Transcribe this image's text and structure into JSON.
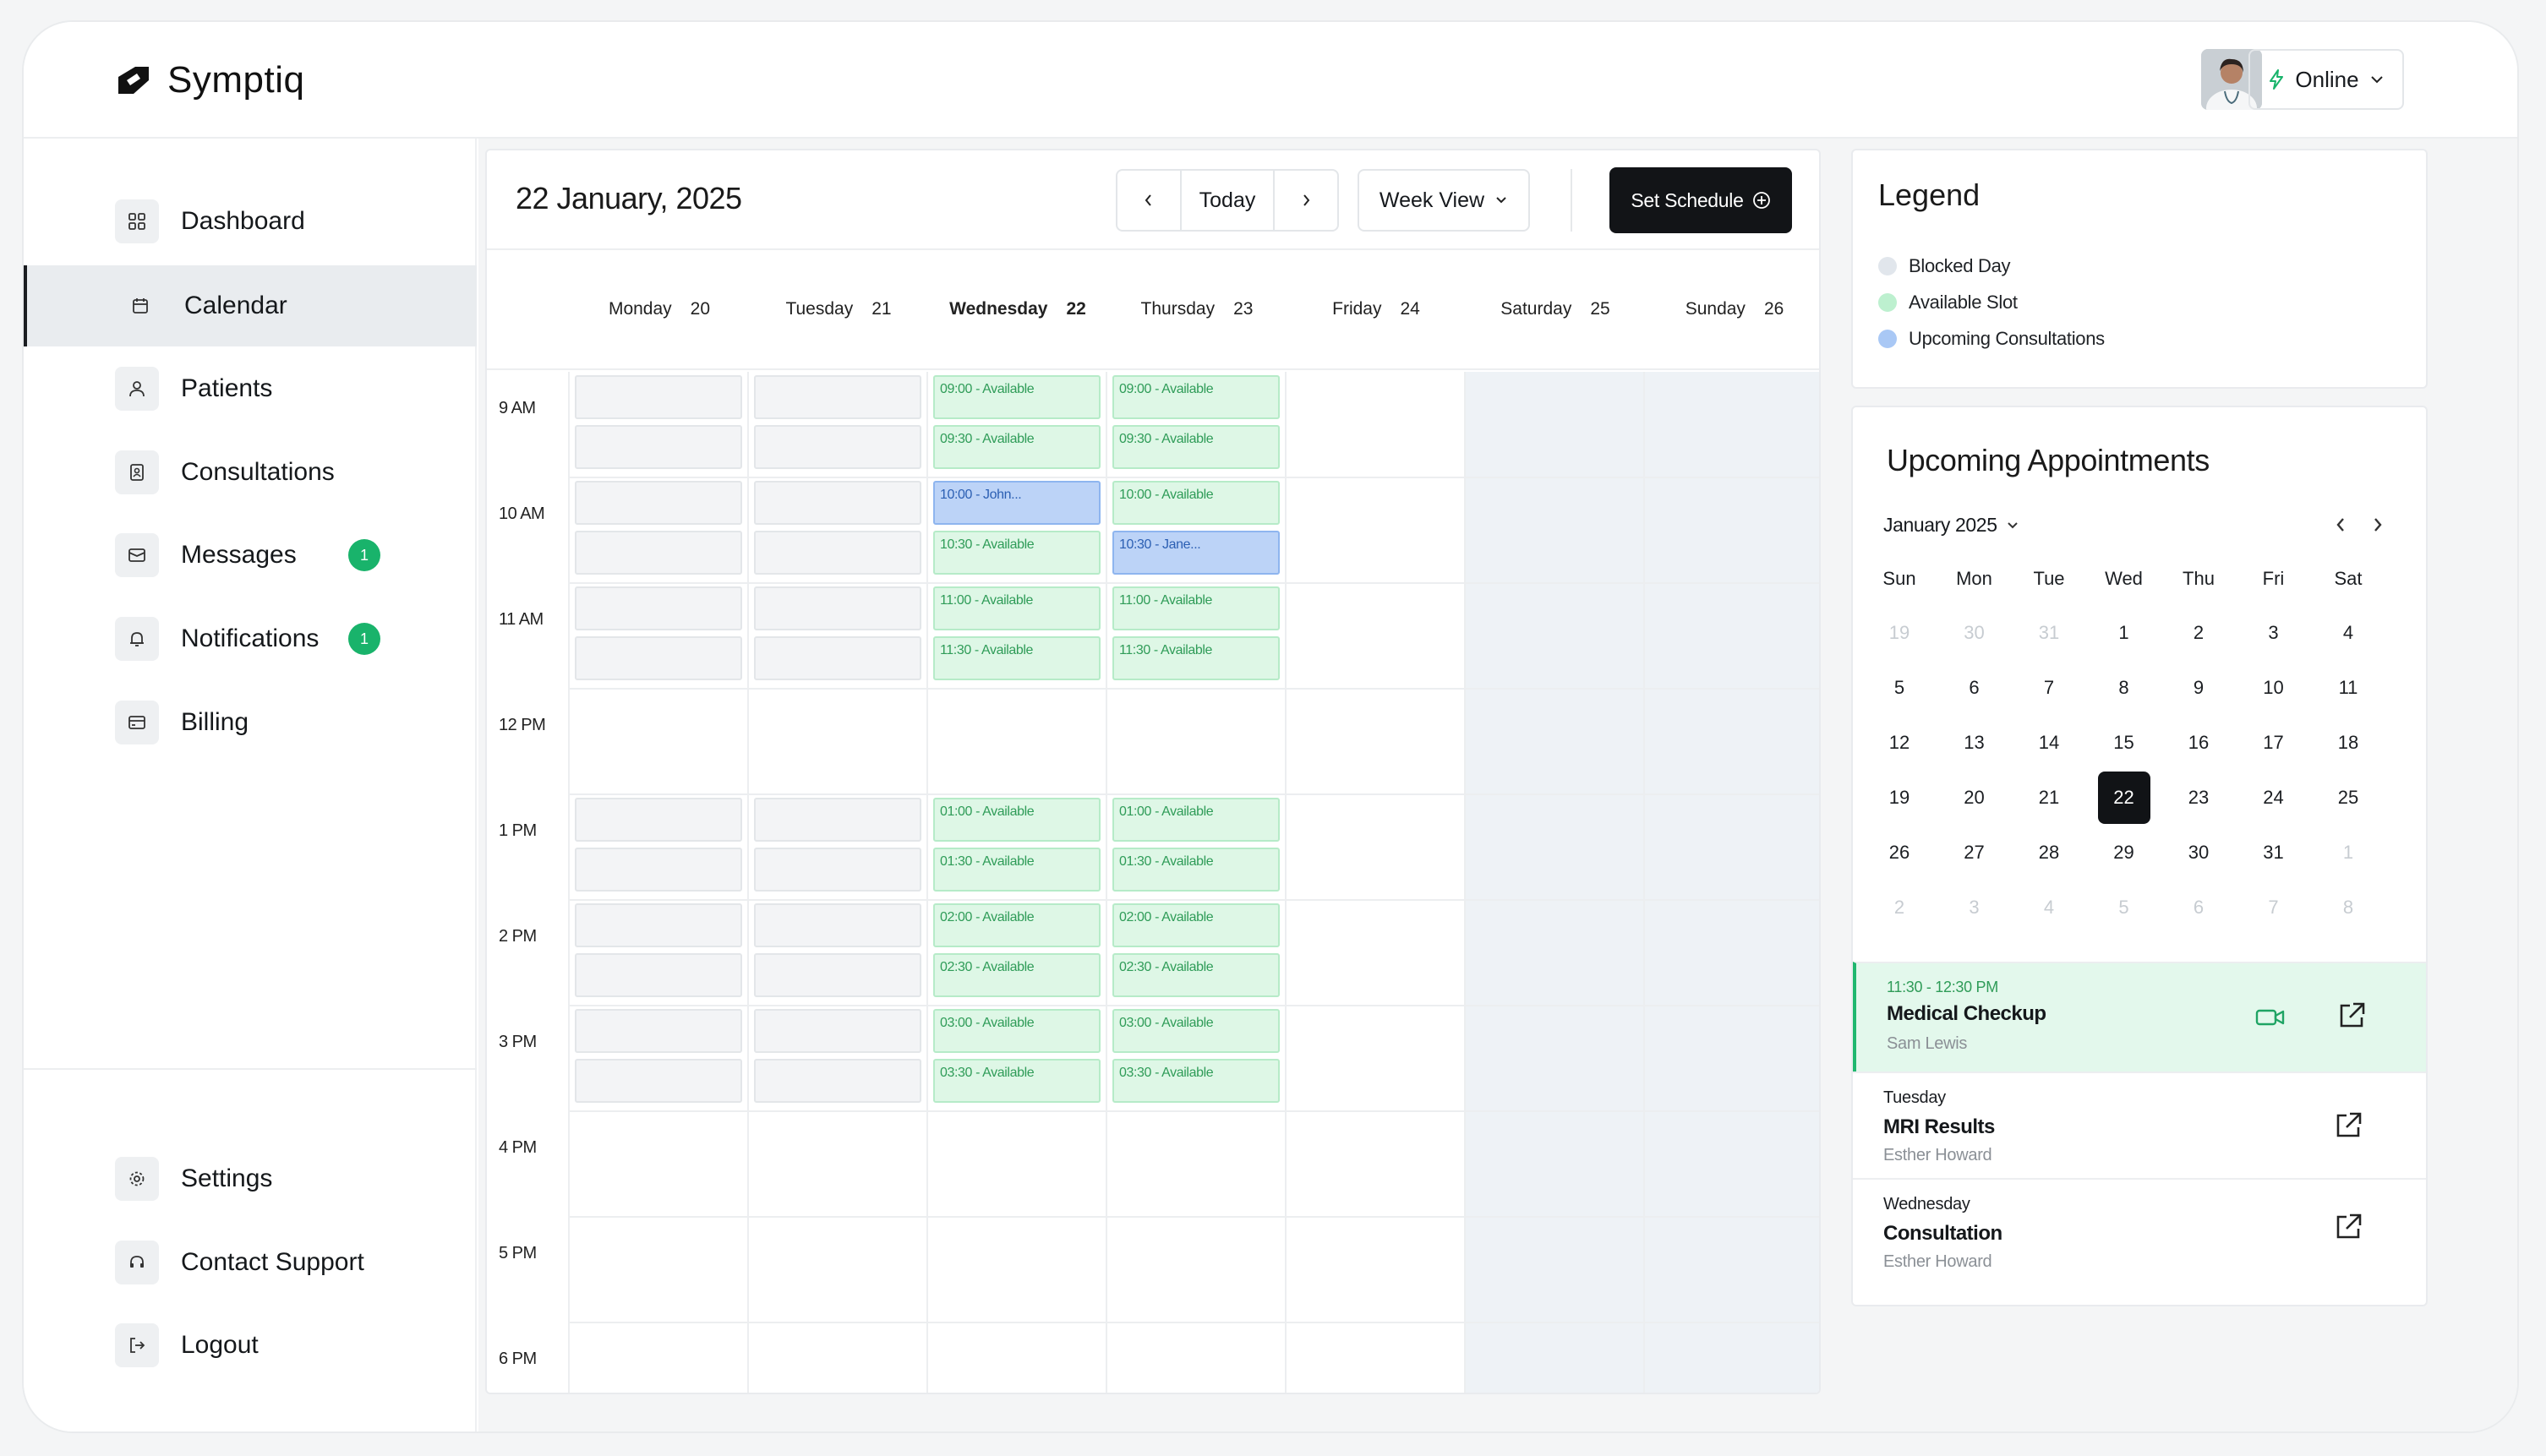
{
  "brand": {
    "name": "Symptiq"
  },
  "header": {
    "status_label": "Online"
  },
  "sidebar": {
    "items": [
      {
        "label": "Dashboard"
      },
      {
        "label": "Calendar"
      },
      {
        "label": "Patients"
      },
      {
        "label": "Consultations"
      },
      {
        "label": "Messages",
        "badge": "1"
      },
      {
        "label": "Notifications",
        "badge": "1"
      },
      {
        "label": "Billing"
      }
    ],
    "bottom": [
      {
        "label": "Settings"
      },
      {
        "label": "Contact Support"
      },
      {
        "label": "Logout"
      }
    ]
  },
  "calendar": {
    "date_title": "22 January, 2025",
    "today_label": "Today",
    "view_label": "Week View",
    "schedule_label": "Set Schedule",
    "days": [
      {
        "name": "Monday",
        "num": "20"
      },
      {
        "name": "Tuesday",
        "num": "21"
      },
      {
        "name": "Wednesday",
        "num": "22"
      },
      {
        "name": "Thursday",
        "num": "23"
      },
      {
        "name": "Friday",
        "num": "24"
      },
      {
        "name": "Saturday",
        "num": "25"
      },
      {
        "name": "Sunday",
        "num": "26"
      }
    ],
    "times": [
      "9 AM",
      "10 AM",
      "11 AM",
      "12 PM",
      "1 PM",
      "2 PM",
      "3 PM",
      "4 PM",
      "5 PM",
      "6 PM"
    ],
    "wednesday": [
      "09:00 - Available",
      "09:30 - Available",
      "10:00 - John...",
      "10:30 - Available",
      "11:00 - Available",
      "11:30 - Available",
      "01:00 - Available",
      "01:30 - Available",
      "02:00 - Available",
      "02:30 - Available",
      "03:00 - Available",
      "03:30 - Available"
    ],
    "thursday": [
      "09:00 - Available",
      "09:30 - Available",
      "10:00 - Available",
      "10:30 - Jane...",
      "11:00 - Available",
      "11:30 - Available",
      "01:00 - Available",
      "01:30 - Available",
      "02:00 - Available",
      "02:30 - Available",
      "03:00 - Available",
      "03:30 - Available"
    ]
  },
  "legend": {
    "title": "Legend",
    "items": [
      {
        "label": "Blocked Day",
        "color": "#e1e6ec"
      },
      {
        "label": "Available Slot",
        "color": "#bdf0cf"
      },
      {
        "label": "Upcoming Consultations",
        "color": "#a9c8f5"
      }
    ]
  },
  "appointments": {
    "title": "Upcoming Appointments",
    "month_label": "January 2025",
    "weekdays": [
      "Sun",
      "Mon",
      "Tue",
      "Wed",
      "Thu",
      "Fri",
      "Sat"
    ],
    "weeks": [
      [
        "19",
        "30",
        "31",
        "1",
        "2",
        "3",
        "4"
      ],
      [
        "5",
        "6",
        "7",
        "8",
        "9",
        "10",
        "11"
      ],
      [
        "12",
        "13",
        "14",
        "15",
        "16",
        "17",
        "18"
      ],
      [
        "19",
        "20",
        "21",
        "22",
        "23",
        "24",
        "25"
      ],
      [
        "26",
        "27",
        "28",
        "29",
        "30",
        "31",
        "1"
      ],
      [
        "2",
        "3",
        "4",
        "5",
        "6",
        "7",
        "8"
      ]
    ],
    "selected_day": "22",
    "items": [
      {
        "time": "11:30 - 12:30 PM",
        "title": "Medical Checkup",
        "patient": "Sam Lewis"
      },
      {
        "day": "Tuesday",
        "title": "MRI Results",
        "patient": "Esther Howard"
      },
      {
        "day": "Wednesday",
        "title": "Consultation",
        "patient": "Esther Howard"
      }
    ]
  },
  "colors": {
    "accent": "#19b36b",
    "dark": "#121417",
    "available_bg": "#def7e6",
    "booked_bg": "#bcd3f7",
    "blocked_bg": "#f3f4f6"
  }
}
